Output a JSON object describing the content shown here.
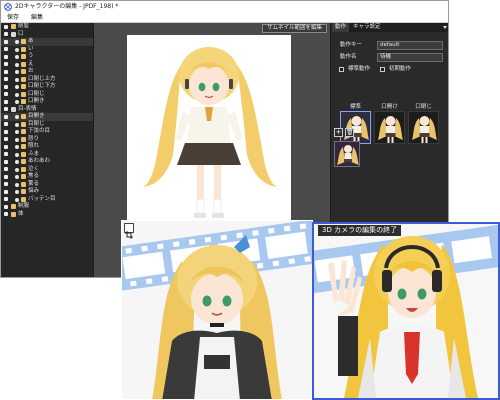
{
  "window": {
    "title": "2Dキャラクターの編集 - JPDF_198) *"
  },
  "menubar": {
    "items": [
      "保存",
      "編集"
    ]
  },
  "left_panel": {
    "rows": [
      {
        "label": "前髪",
        "kind": "group"
      },
      {
        "label": "口",
        "kind": "folder"
      },
      {
        "label": "あ",
        "kind": "item",
        "selected": true
      },
      {
        "label": "い",
        "kind": "item"
      },
      {
        "label": "う",
        "kind": "item"
      },
      {
        "label": "え",
        "kind": "item"
      },
      {
        "label": "お",
        "kind": "item"
      },
      {
        "label": "口閉じ上方",
        "kind": "item"
      },
      {
        "label": "口閉じ下方",
        "kind": "item"
      },
      {
        "label": "口閉じ",
        "kind": "item"
      },
      {
        "label": "口開き",
        "kind": "item"
      },
      {
        "label": "目-表情",
        "kind": "folder"
      },
      {
        "label": "目開き",
        "kind": "item",
        "selected": true
      },
      {
        "label": "目閉じ",
        "kind": "item"
      },
      {
        "label": "下弦の目",
        "kind": "item"
      },
      {
        "label": "怒り",
        "kind": "item"
      },
      {
        "label": "照れ",
        "kind": "item"
      },
      {
        "label": "ふま",
        "kind": "item"
      },
      {
        "label": "あわあわ",
        "kind": "item"
      },
      {
        "label": "泣く",
        "kind": "item"
      },
      {
        "label": "焦る",
        "kind": "item"
      },
      {
        "label": "驚る",
        "kind": "item"
      },
      {
        "label": "悩み",
        "kind": "item"
      },
      {
        "label": "バッテン目",
        "kind": "item"
      },
      {
        "label": "制服",
        "kind": "group"
      },
      {
        "label": "体",
        "kind": "group"
      }
    ]
  },
  "center": {
    "thumb_button": "サムネイル範囲を編集"
  },
  "right_panel": {
    "tabs": [
      "動作",
      "キャラ設定"
    ],
    "motion_key_label": "動作キー",
    "motion_key_value": "default",
    "motion_name_label": "動作名",
    "motion_name_value": "待機",
    "standard_motion_label": "標準動作",
    "initial_motion_label": "初期動作",
    "motion_tabs": [
      "標準",
      "口開け",
      "口閉じ"
    ],
    "add_button": "+",
    "delete_button": "🗑"
  },
  "overlay_right": {
    "label": "3D カメラの編集の終了"
  },
  "colors": {
    "selection": "#8aa0ff",
    "accent_border": "#3d5bd3"
  }
}
